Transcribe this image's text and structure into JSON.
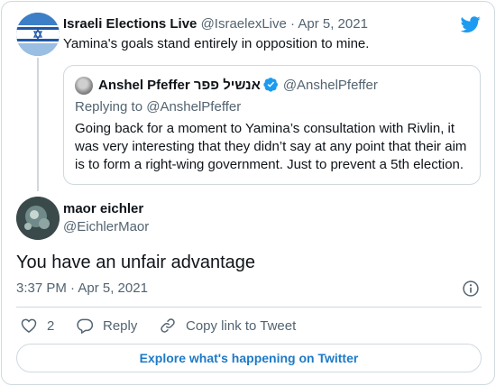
{
  "colors": {
    "brand_blue": "#1d9bf0",
    "link_blue": "#1d7ac7",
    "text_primary": "#0f1419",
    "text_secondary": "#536471",
    "border": "#cfd9de"
  },
  "parent_tweet": {
    "author_name": "Israeli Elections Live",
    "handle": "@IsraelexLive",
    "separator": "·",
    "date": "Apr 5, 2021",
    "text": "Yamina's goals stand entirely in opposition to mine."
  },
  "quoted_tweet": {
    "author_name": "Anshel Pfeffer אנשיל פפר",
    "handle": "@AnshelPfeffer",
    "replying_to": "Replying to @AnshelPfeffer",
    "text": "Going back for a moment to Yamina’s consultation with Rivlin, it was very interesting that they didn’t say at any point that their aim is to form a right-wing government. Just to prevent a 5th election."
  },
  "main_tweet": {
    "author_name": "maor eichler",
    "handle": "@EichlerMaor",
    "text": "You have an unfair advantage",
    "timestamp": "3:37 PM · Apr 5, 2021"
  },
  "actions": {
    "like_count": "2",
    "reply_label": "Reply",
    "copy_link_label": "Copy link to Tweet"
  },
  "footer": {
    "explore_label": "Explore what's happening on Twitter"
  },
  "icons": {
    "brand": "twitter-bird-icon",
    "verified": "verified-badge-icon",
    "info": "info-icon",
    "like": "heart-icon",
    "reply": "reply-bubble-icon",
    "copy_link": "link-icon"
  }
}
